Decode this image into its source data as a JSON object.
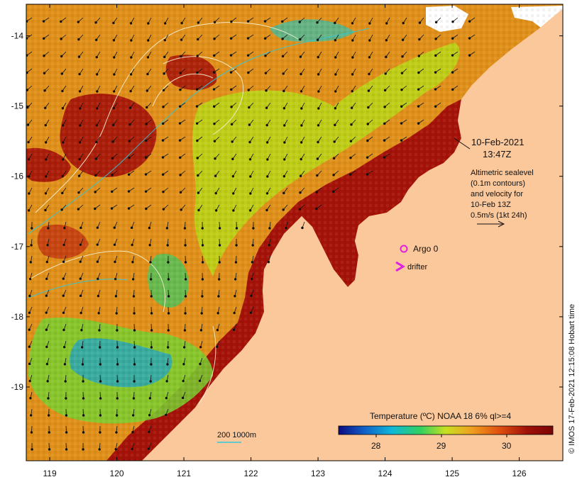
{
  "map": {
    "x_ticks": [
      "119",
      "120",
      "121",
      "122",
      "123",
      "124",
      "125",
      "126"
    ],
    "y_ticks": [
      "-14",
      "-15",
      "-16",
      "-17",
      "-18",
      "-19"
    ],
    "x_range": [
      118.65,
      126.65
    ],
    "y_range": [
      -20.05,
      -13.55
    ]
  },
  "annotation": {
    "date": "10-Feb-2021",
    "time": "13:47Z",
    "altimetry_lines": [
      "Altimetric sealevel",
      "(0.1m contours)",
      "and velocity for",
      "10-Feb 13Z",
      "0.5m/s (1kt 24h)"
    ]
  },
  "legend_markers": {
    "argo_label": "Argo 0",
    "drifter_label": "drifter",
    "argo_color": "#e020e0",
    "drifter_color": "#e020e0"
  },
  "bathymetry_label": "200  1000m",
  "colorbar": {
    "title": "Temperature (ºC) NOAA 18 6% ql>=4",
    "ticks": [
      "28",
      "29",
      "30"
    ],
    "stops": [
      "#0a0a80",
      "#1060c8",
      "#10b8d8",
      "#30d060",
      "#c8e020",
      "#f0a020",
      "#e05010",
      "#a01008",
      "#7a0505"
    ]
  },
  "credit": "© IMOS 17-Feb-2021 12:15:08 Hobart time",
  "colors": {
    "land": "#fbc89c",
    "warm_sst": "#a51208",
    "mid_sst": "#e0901a"
  }
}
